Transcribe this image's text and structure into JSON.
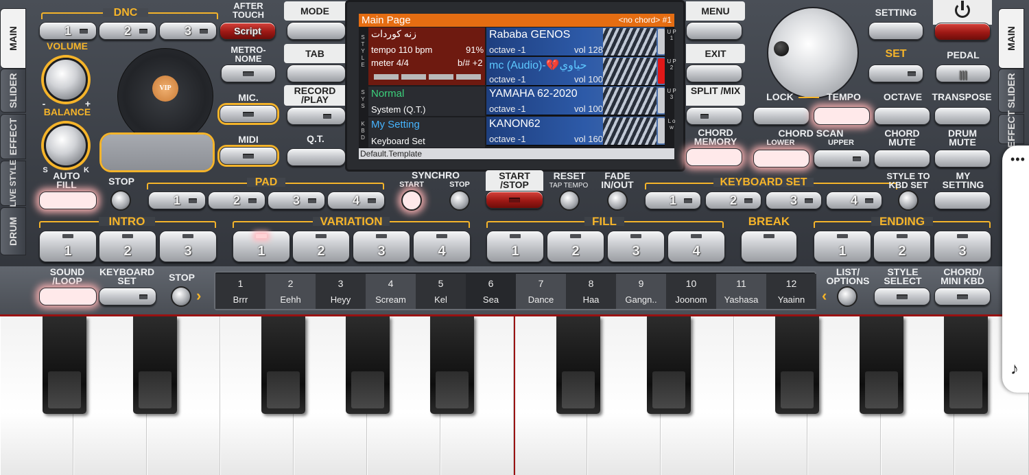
{
  "side_tabs_left": [
    "MAIN",
    "SLIDER",
    "EFFECT",
    "LIVE STYLE",
    "DRUM"
  ],
  "side_tabs_right": [
    "MAIN",
    "SLIDER",
    "EFFECT"
  ],
  "dnc": {
    "label": "DNC",
    "buttons": [
      "1",
      "2",
      "3"
    ],
    "script": "Script"
  },
  "after_touch": "AFTER TOUCH",
  "metronome": "METRO- NOME",
  "mic": "MIC.",
  "midi": "MIDI",
  "volume": "VOLUME",
  "balance": "BALANCE",
  "balance_minus": "-",
  "balance_plus": "+",
  "balance_s": "S",
  "balance_k": "K",
  "vip": "VIP",
  "mode": "MODE",
  "tab": "TAB",
  "record_play": "RECORD /PLAY",
  "qt": "Q.T.",
  "menu": "MENU",
  "exit": "EXIT",
  "split_mix": "SPLIT /MIX",
  "chord_memory": "CHORD MEMORY",
  "setting": "SETTING",
  "set": "SET",
  "pedal": "PEDAL",
  "lock": "LOCK",
  "tempo": "TEMPO",
  "octave": "OCTAVE",
  "transpose": "TRANSPOSE",
  "chord_scan": {
    "label": "CHORD SCAN",
    "lower": "LOWER",
    "upper": "UPPER"
  },
  "chord_mute": "CHORD MUTE",
  "drum_mute": "DRUM MUTE",
  "screen": {
    "title": "Main Page",
    "chord": "<no chord> #1",
    "style_name": "زنه كوردات",
    "tempo": "tempo 110 bpm",
    "tempo_pct": "91%",
    "meter": "meter 4/4",
    "key": "b/# +2",
    "style_label": "S T Y L E",
    "sys_label": "S Y S",
    "kbd_label": "K B D",
    "sys_name": "Normal",
    "sys_sub": "System (Q.T.)",
    "kbd_name": "My Setting",
    "kbd_sub": "Keyboard Set",
    "footer": "Default.Template",
    "voices": [
      {
        "name": "Rababa GENOS",
        "octave": "octave -1",
        "vol": "vol 128",
        "tag": "U P 1"
      },
      {
        "name": "mc (Audio)-💔حياوي",
        "octave": "octave -1",
        "vol": "vol 100",
        "tag": "U P 2"
      },
      {
        "name": "YAMAHA 62-2020",
        "octave": "octave -1",
        "vol": "vol 100",
        "tag": "U P 3"
      },
      {
        "name": "KANON62",
        "octave": "octave -1",
        "vol": "vol 160",
        "tag": "L o w"
      }
    ]
  },
  "auto_fill": "AUTO FILL",
  "stop": "STOP",
  "pad": {
    "label": "PAD",
    "buttons": [
      "1",
      "2",
      "3",
      "4"
    ]
  },
  "synchro": {
    "label": "SYNCHRO",
    "start": "START",
    "stop": "STOP"
  },
  "start_stop": "START /STOP",
  "reset": {
    "label": "RESET",
    "sub": "TAP TEMPO"
  },
  "fade": "FADE IN/OUT",
  "keyboard_set": {
    "label": "KEYBOARD SET",
    "buttons": [
      "1",
      "2",
      "3",
      "4"
    ]
  },
  "style_to_kbd": "STYLE TO KBD SET",
  "my_setting": "MY SETTING",
  "intro": {
    "label": "INTRO",
    "buttons": [
      "1",
      "2",
      "3"
    ]
  },
  "variation": {
    "label": "VARIATION",
    "buttons": [
      "1",
      "2",
      "3",
      "4"
    ]
  },
  "fill": {
    "label": "FILL",
    "buttons": [
      "1",
      "2",
      "3",
      "4"
    ]
  },
  "break": "BREAK",
  "ending": {
    "label": "ENDING",
    "buttons": [
      "1",
      "2",
      "3"
    ]
  },
  "sound_loop": "SOUND /LOOP",
  "keyboard_set_btn": "KEYBOARD SET",
  "stop2": "STOP",
  "list_options": "LIST/ OPTIONS",
  "style_select": "STYLE SELECT",
  "chord_mini_kbd": "CHORD/ MINI KBD",
  "pads": [
    {
      "n": "1",
      "t": "Brrr"
    },
    {
      "n": "2",
      "t": "Eehh"
    },
    {
      "n": "3",
      "t": "Heyy"
    },
    {
      "n": "4",
      "t": "Scream"
    },
    {
      "n": "5",
      "t": "Kel"
    },
    {
      "n": "6",
      "t": "Sea"
    },
    {
      "n": "7",
      "t": "Dance"
    },
    {
      "n": "8",
      "t": "Haa"
    },
    {
      "n": "9",
      "t": "Gangn.."
    },
    {
      "n": "10",
      "t": "Joonom"
    },
    {
      "n": "11",
      "t": "Yashasa"
    },
    {
      "n": "12",
      "t": "Yaainn"
    }
  ],
  "edge_menu": {
    "dots": "•••",
    "music_icon": "♪"
  },
  "colors": {
    "accent": "#f5b42a",
    "screen_title": "#e56d12",
    "led_glow": "#ffd7da",
    "start_red": "#b0231d"
  }
}
